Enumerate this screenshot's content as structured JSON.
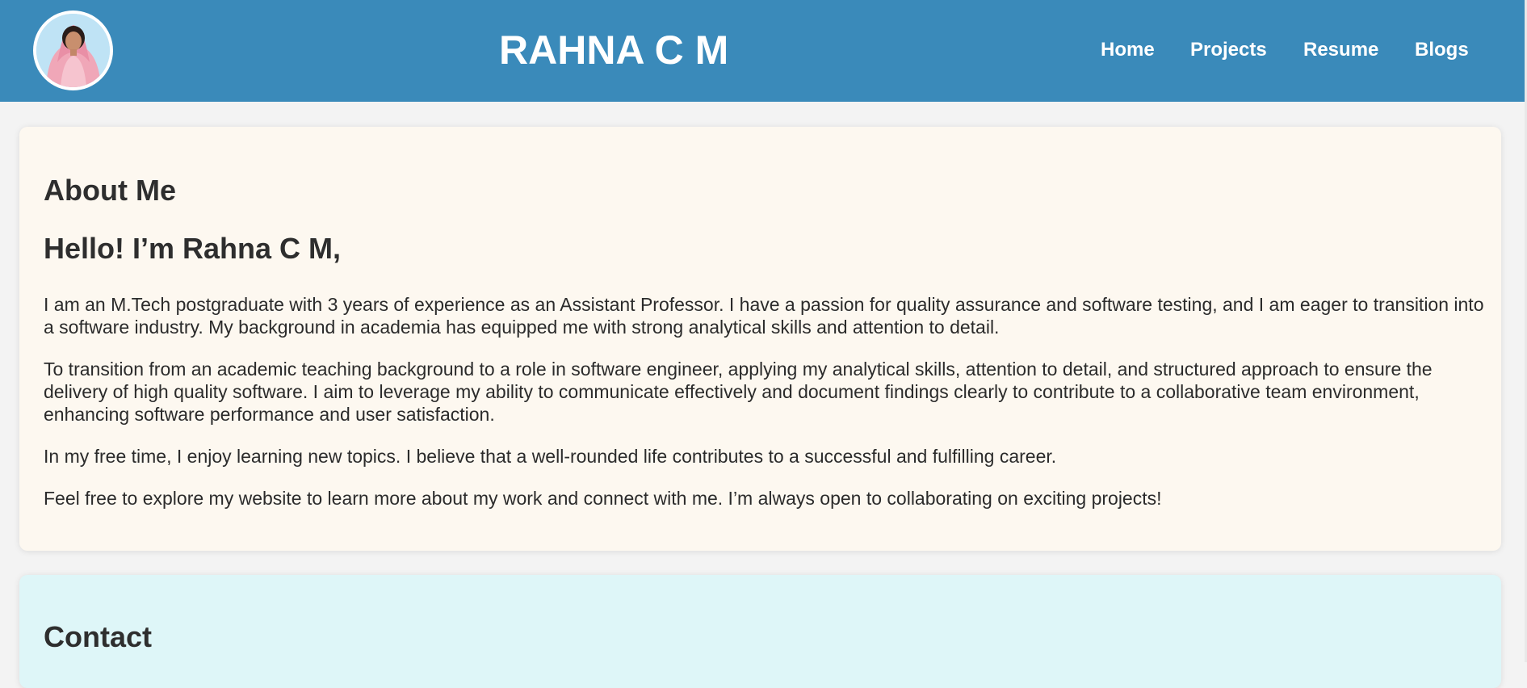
{
  "header": {
    "title": "RAHNA C M",
    "avatar_alt": "Profile photo",
    "nav": [
      {
        "label": "Home"
      },
      {
        "label": "Projects"
      },
      {
        "label": "Resume"
      },
      {
        "label": "Blogs"
      }
    ],
    "background_color": "#3a8aba"
  },
  "about": {
    "heading": "About Me",
    "greeting": "Hello! I’m Rahna C M,",
    "paragraphs": [
      "I am an M.Tech postgraduate with 3 years of experience as an Assistant Professor. I have a passion for quality assurance and software testing, and I am eager to transition into a software industry. My background in academia has equipped me with strong analytical skills and attention to detail.",
      "To transition from an academic teaching background to a role in software engineer, applying my analytical skills, attention to detail, and structured approach to ensure the delivery of high quality software. I aim to leverage my ability to communicate effectively and document findings clearly to contribute to a collaborative team environment, enhancing software performance and user satisfaction.",
      "In my free time, I enjoy learning new topics. I believe that a well-rounded life contributes to a successful and fulfilling career.",
      "Feel free to explore my website to learn more about my work and connect with me. I’m always open to collaborating on exciting projects!"
    ],
    "background_color": "#fdf8f0"
  },
  "contact": {
    "heading": "Contact",
    "background_color": "#def6f8"
  }
}
